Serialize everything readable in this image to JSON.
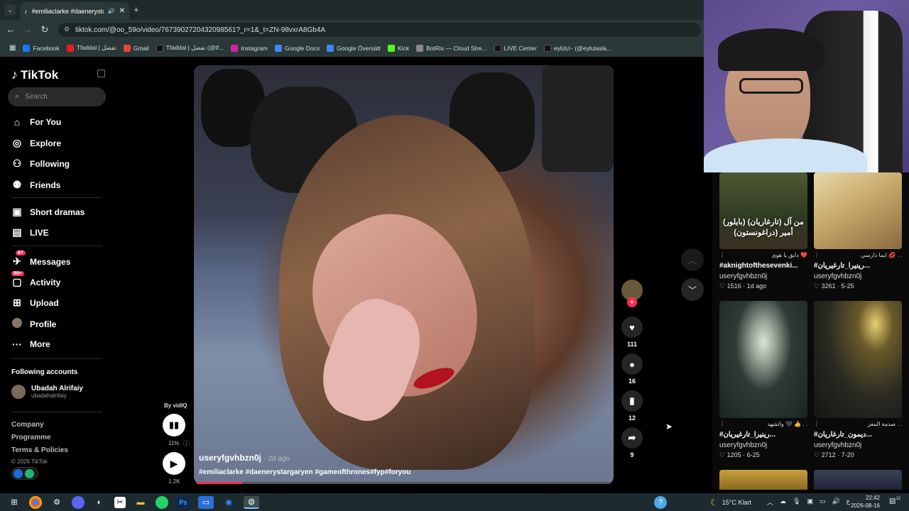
{
  "browser": {
    "tab_title": "#emiliaclarke #daenerystar",
    "new_tab": "+",
    "url": "tiktok.com/@oo_59o/video/7673902720432098561?_r=1&_t=ZN-98vxrA8Gb4A",
    "bookmarks": [
      {
        "label": "Facebook",
        "color": "#1877f2"
      },
      {
        "label": "Tfaddal | تفضل",
        "color": "#e62117"
      },
      {
        "label": "Gmail",
        "color": "#ea4335"
      },
      {
        "label": "Tfaddal | تفضل (@tf...",
        "color": "#111111"
      },
      {
        "label": "Instagram",
        "color": "#d6249f"
      },
      {
        "label": "Google Docs",
        "color": "#4285f4"
      },
      {
        "label": "Google Översätt",
        "color": "#4285f4"
      },
      {
        "label": "Kick",
        "color": "#53fc18"
      },
      {
        "label": "BotRix — Cloud Stre...",
        "color": "#888888"
      },
      {
        "label": "LIVE Center",
        "color": "#111111"
      },
      {
        "label": "eylül¡l~ (@eylulasla...",
        "color": "#111111"
      }
    ]
  },
  "tiktok": {
    "logo": "TikTok",
    "search_placeholder": "Search",
    "nav": [
      {
        "label": "For You",
        "icon": "home-icon"
      },
      {
        "label": "Explore",
        "icon": "compass-icon"
      },
      {
        "label": "Following",
        "icon": "following-icon"
      },
      {
        "label": "Friends",
        "icon": "friends-icon"
      },
      {
        "label": "Short dramas",
        "icon": "drama-icon"
      },
      {
        "label": "LIVE",
        "icon": "live-icon"
      },
      {
        "label": "Messages",
        "icon": "messages-icon",
        "badge": "87"
      },
      {
        "label": "Activity",
        "icon": "activity-icon",
        "badge": "99+"
      },
      {
        "label": "Upload",
        "icon": "upload-icon"
      },
      {
        "label": "Profile",
        "icon": "profile-icon"
      },
      {
        "label": "More",
        "icon": "more-icon"
      }
    ],
    "following_accounts_title": "Following accounts",
    "following_account": {
      "name": "Ubadah Alrifaiy",
      "handle": "ubadahalrifaiy"
    },
    "footer": [
      "Company",
      "Programme",
      "Terms & Policies",
      "© 2026 TikTok"
    ]
  },
  "video": {
    "username": "useryfgvhbzn0j",
    "ago": "· 2d ago",
    "caption": "#emiliaclarke #daenerystargaryen #gameofthrones#fyp#foryou",
    "progress": 0.11,
    "by_vidiq": "By vidIQ",
    "percent": "11%",
    "views": "1.2K",
    "likes": "111",
    "comments": "16",
    "saves": "12",
    "shares": "9"
  },
  "related": [
    {
      "overlay": "(بايلور) من آل (تارغاريان) أمير (دراغونستون)",
      "title": "دايق يا هوى ❤️",
      "tag": "#aknightofthesevenki...",
      "user": "useryfgvhbzn0j",
      "stats": "♡ 1516 · 1d ago"
    },
    {
      "overlay": "",
      "title": "ايما دارسي 💋 . .",
      "tag": "#رينيرا_تارغيريان...",
      "user": "useryfgvhbzn0j",
      "stats": "♡ 3261 · 5-25"
    },
    {
      "overlay": "",
      "title": "واتشهد 🖤 👍 . .",
      "tag": "#رينيرا_تارغيريان...",
      "user": "useryfgvhbzn0j",
      "stats": "♡ 1205 · 6-25"
    },
    {
      "overlay": "",
      "title": "صدمة المعر . .",
      "tag": "#ديمون_تارغاريان...",
      "user": "useryfgvhbzn0j",
      "stats": "♡ 2712 · 7-20"
    }
  ],
  "taskbar": {
    "weather": "15°C  Klart",
    "time": "22:42",
    "date": "2026-08-16",
    "lang": "ع",
    "notif": "12"
  }
}
